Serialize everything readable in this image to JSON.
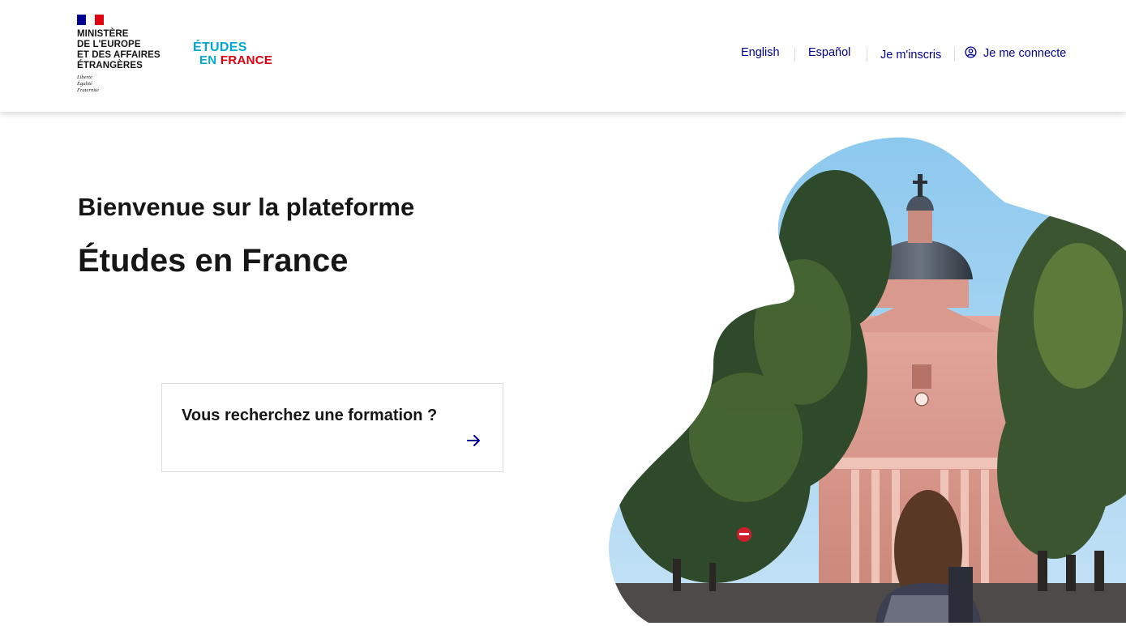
{
  "header": {
    "ministry_lines": [
      "MINISTÈRE",
      "DE L'EUROPE",
      "ET DES AFFAIRES",
      "ÉTRANGÈRES"
    ],
    "motto_lines": [
      "Liberté",
      "Égalité",
      "Fraternité"
    ],
    "brand": {
      "line1": "ÉTUDES",
      "line2_a": "EN ",
      "line2_b": "FRANCE"
    }
  },
  "nav": {
    "english": "English",
    "espanol": "Español",
    "register": "Je m'inscris",
    "login": "Je me connecte",
    "login_icon": "user-circle-icon"
  },
  "main": {
    "welcome": "Bienvenue sur la plateforme",
    "title": "Études en France",
    "search_card": {
      "label": "Vous recherchez une formation ?",
      "icon": "arrow-right-icon"
    }
  },
  "colors": {
    "accent": "#000091",
    "brand_blue": "#00a9ce",
    "brand_red": "#e1000f",
    "text": "#161616",
    "border": "#dddddd"
  }
}
